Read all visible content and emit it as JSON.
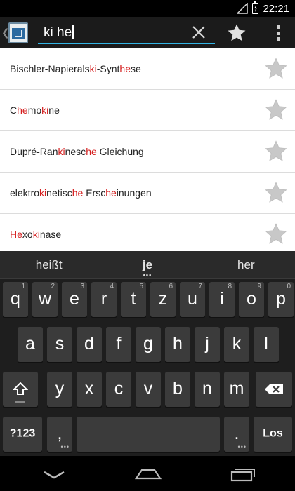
{
  "status_bar": {
    "time": "22:21"
  },
  "search": {
    "query": "ki he"
  },
  "results": [
    {
      "parts": [
        {
          "t": "Bischler-Napieral",
          "h": false
        },
        {
          "t": "s",
          "h": false
        },
        {
          "t": "ki",
          "h": true
        },
        {
          "t": "-Synt",
          "h": false
        },
        {
          "t": "he",
          "h": true
        },
        {
          "t": "se",
          "h": false
        }
      ]
    },
    {
      "parts": [
        {
          "t": "C",
          "h": false
        },
        {
          "t": "he",
          "h": true
        },
        {
          "t": "mo",
          "h": false
        },
        {
          "t": "ki",
          "h": true
        },
        {
          "t": "ne",
          "h": false
        }
      ]
    },
    {
      "parts": [
        {
          "t": "Dupré-Ran",
          "h": false
        },
        {
          "t": "ki",
          "h": true
        },
        {
          "t": "nesc",
          "h": false
        },
        {
          "t": "he",
          "h": true
        },
        {
          "t": " Gleichung",
          "h": false
        }
      ]
    },
    {
      "parts": [
        {
          "t": "elektro",
          "h": false
        },
        {
          "t": "ki",
          "h": true
        },
        {
          "t": "netisc",
          "h": false
        },
        {
          "t": "he",
          "h": true
        },
        {
          "t": " Ersc",
          "h": false
        },
        {
          "t": "he",
          "h": true
        },
        {
          "t": "inungen",
          "h": false
        }
      ]
    },
    {
      "parts": [
        {
          "t": "He",
          "h": true
        },
        {
          "t": "xo",
          "h": false
        },
        {
          "t": "ki",
          "h": true
        },
        {
          "t": "nase",
          "h": false
        }
      ]
    }
  ],
  "keyboard": {
    "suggestions": [
      "heißt",
      "je",
      "her"
    ],
    "row1": [
      {
        "k": "q",
        "n": "1"
      },
      {
        "k": "w",
        "n": "2"
      },
      {
        "k": "e",
        "n": "3"
      },
      {
        "k": "r",
        "n": "4"
      },
      {
        "k": "t",
        "n": "5"
      },
      {
        "k": "z",
        "n": "6"
      },
      {
        "k": "u",
        "n": "7"
      },
      {
        "k": "i",
        "n": "8"
      },
      {
        "k": "o",
        "n": "9"
      },
      {
        "k": "p",
        "n": "0"
      }
    ],
    "row2": [
      "a",
      "s",
      "d",
      "f",
      "g",
      "h",
      "j",
      "k",
      "l"
    ],
    "row3": [
      "y",
      "x",
      "c",
      "v",
      "b",
      "n",
      "m"
    ],
    "symbols_label": "?123",
    "comma_label": ",",
    "period_label": ".",
    "enter_label": "Los"
  },
  "colors": {
    "accent": "#33b5e5",
    "highlight": "#d51e1e",
    "star": "#c8c8c8"
  }
}
